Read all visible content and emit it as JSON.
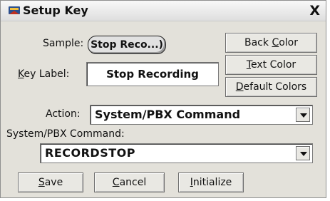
{
  "window": {
    "title": "Setup Key",
    "close_label": "X"
  },
  "sample": {
    "label": "Sample:",
    "button_text": "Stop Reco...)"
  },
  "key_label": {
    "label_k": "K",
    "label_rest": "ey Label:",
    "value": "Stop Recording"
  },
  "color_buttons": {
    "back_pre": "Back ",
    "back_ul": "C",
    "back_post": "olor",
    "text_ul": "T",
    "text_post": "ext Color",
    "default_ul": "D",
    "default_post": "efault Colors"
  },
  "action": {
    "label": "Action:",
    "value": "System/PBX Command"
  },
  "command": {
    "label": "System/PBX Command:",
    "value": "RECORDSTOP"
  },
  "footer_buttons": {
    "save_ul": "S",
    "save_post": "ave",
    "cancel_ul": "C",
    "cancel_post": "ancel",
    "init_ul": "I",
    "init_post": "nitialize"
  }
}
